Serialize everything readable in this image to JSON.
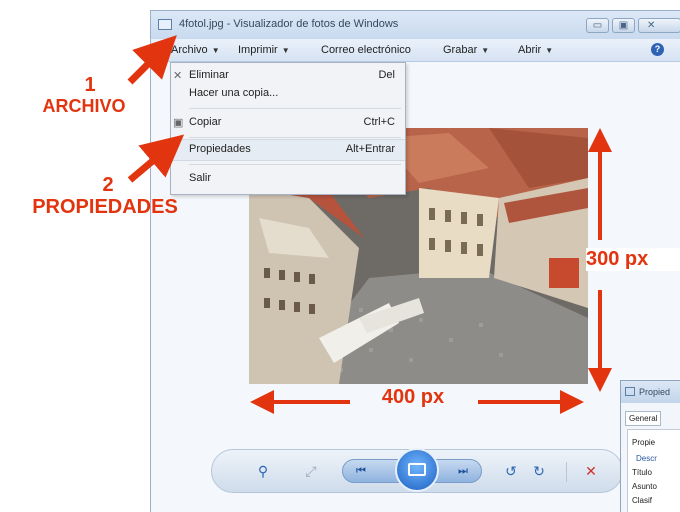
{
  "window": {
    "title": "4fotol.jpg - Visualizador de fotos de Windows",
    "controls": {
      "minimize": "▭",
      "maximize": "▣",
      "close": "✕"
    }
  },
  "menubar": {
    "items": [
      {
        "label": "Archivo"
      },
      {
        "label": "Imprimir"
      },
      {
        "label": "Correo electrónico"
      },
      {
        "label": "Grabar"
      },
      {
        "label": "Abrir"
      }
    ],
    "help": "?"
  },
  "file_menu": {
    "items": [
      {
        "label": "Eliminar",
        "shortcut": "Del",
        "icon": "delete-icon"
      },
      {
        "label": "Hacer una copia...",
        "shortcut": ""
      },
      {
        "label": "Copiar",
        "shortcut": "Ctrl+C",
        "icon": "copy-icon"
      },
      {
        "label": "Propiedades",
        "shortcut": "Alt+Entrar",
        "highlighted": true
      },
      {
        "label": "Salir",
        "shortcut": ""
      }
    ]
  },
  "annotations": {
    "step1_number": "1",
    "step1_label": "ARCHIVO",
    "step2_number": "2",
    "step2_label": "PROPIEDADES",
    "height_label": "300 px",
    "width_label": "400 px",
    "color": "#e2350f"
  },
  "toolbar": {
    "zoom": "⚲",
    "fit": "⤢",
    "prev": "⏮",
    "next": "⏭",
    "rotate_left": "↺",
    "rotate_right": "↻",
    "delete": "✕"
  },
  "properties_window": {
    "title": "Propied",
    "tab": "General",
    "group": "Propie",
    "section": "Descr",
    "row1": "Título",
    "row2": "Asunto",
    "row3": "Clasif"
  }
}
